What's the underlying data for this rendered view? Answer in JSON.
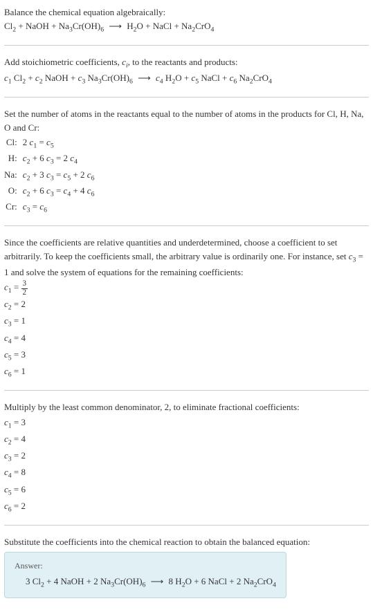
{
  "intro": {
    "line1": "Balance the chemical equation algebraically:"
  },
  "reactants": [
    "Cl₂",
    "NaOH",
    "Na₃Cr(OH)₆"
  ],
  "products": [
    "H₂O",
    "NaCl",
    "Na₂CrO₄"
  ],
  "stoich": {
    "line1": "Add stoichiometric coefficients, ",
    "line1_suffix": ", to the reactants and products:"
  },
  "atoms_intro": "Set the number of atoms in the reactants equal to the number of atoms in the products for Cl, H, Na, O and Cr:",
  "atoms": [
    {
      "el": "Cl:",
      "eq": "2 c₁ = c₅"
    },
    {
      "el": "H:",
      "eq": "c₂ + 6 c₃ = 2 c₄"
    },
    {
      "el": "Na:",
      "eq": "c₂ + 3 c₃ = c₅ + 2 c₆"
    },
    {
      "el": "O:",
      "eq": "c₂ + 6 c₃ = c₄ + 4 c₆"
    },
    {
      "el": "Cr:",
      "eq": "c₃ = c₆"
    }
  ],
  "underdet": "Since the coefficients are relative quantities and underdetermined, choose a coefficient to set arbitrarily. To keep the coefficients small, the arbitrary value is ordinarily one. For instance, set c₃ = 1 and solve the system of equations for the remaining coefficients:",
  "solution1": [
    {
      "lhs": "c₁ = ",
      "num": "3",
      "den": "2"
    },
    {
      "lhs": "c₂ = 2"
    },
    {
      "lhs": "c₃ = 1"
    },
    {
      "lhs": "c₄ = 4"
    },
    {
      "lhs": "c₅ = 3"
    },
    {
      "lhs": "c₆ = 1"
    }
  ],
  "lcd": "Multiply by the least common denominator, 2, to eliminate fractional coefficients:",
  "solution2": [
    {
      "lhs": "c₁ = 3"
    },
    {
      "lhs": "c₂ = 4"
    },
    {
      "lhs": "c₃ = 2"
    },
    {
      "lhs": "c₄ = 8"
    },
    {
      "lhs": "c₅ = 6"
    },
    {
      "lhs": "c₆ = 2"
    }
  ],
  "subst": "Substitute the coefficients into the chemical reaction to obtain the balanced equation:",
  "answer": {
    "label": "Answer:",
    "coefs_r": [
      3,
      4,
      2
    ],
    "coefs_p": [
      8,
      6,
      2
    ]
  }
}
